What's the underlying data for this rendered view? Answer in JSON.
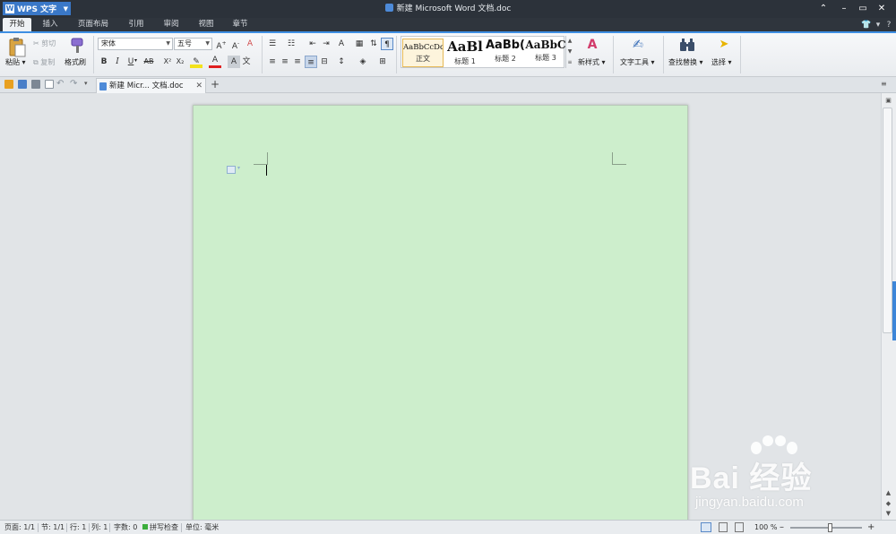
{
  "app": {
    "menu_label": "WPS 文字",
    "logo_letter": "W"
  },
  "window": {
    "title": "新建 Microsoft Word 文档.doc"
  },
  "menu_tabs": [
    "开始",
    "插入",
    "页面布局",
    "引用",
    "审阅",
    "视图",
    "章节"
  ],
  "ribbon": {
    "clipboard": {
      "paste": "粘贴",
      "cut": "剪切",
      "copy": "复制",
      "format_painter": "格式刷"
    },
    "font": {
      "name": "宋体",
      "size": "五号"
    },
    "format_buttons": {
      "bold": "B",
      "italic": "I",
      "underline": "U",
      "strike": "AB",
      "superscript": "X²",
      "subscript": "X₂",
      "font_color": "A",
      "char_shading": "A",
      "phonetic": "文"
    },
    "styles": [
      {
        "preview": "AaBbCcDd",
        "name": "正文"
      },
      {
        "preview": "AaBl",
        "name": "标题 1"
      },
      {
        "preview": "AaBb(",
        "name": "标题 2"
      },
      {
        "preview": "AaBbC",
        "name": "标题 3"
      }
    ],
    "new_style": "新样式",
    "text_tools": "文字工具",
    "find_replace": "查找替换",
    "select": "选择"
  },
  "document_tab": {
    "label": "新建 Micr... 文档.doc"
  },
  "status": {
    "page": "页面: 1/1",
    "section": "节: 1/1",
    "line": "行: 1",
    "column": "列: 1",
    "word_count": "字数: 0",
    "spell_check": "拼写检查",
    "unit": "单位: 毫米",
    "zoom": "100 %"
  },
  "zoom_level": 0.55,
  "watermark": {
    "main": "Bai 经验",
    "sub": "jingyan.baidu.com"
  },
  "colors": {
    "title_bg": "#2c323a",
    "accent": "#3f8fe3",
    "page_bg": "#cdeecc",
    "app_button": "#3a78c8"
  }
}
